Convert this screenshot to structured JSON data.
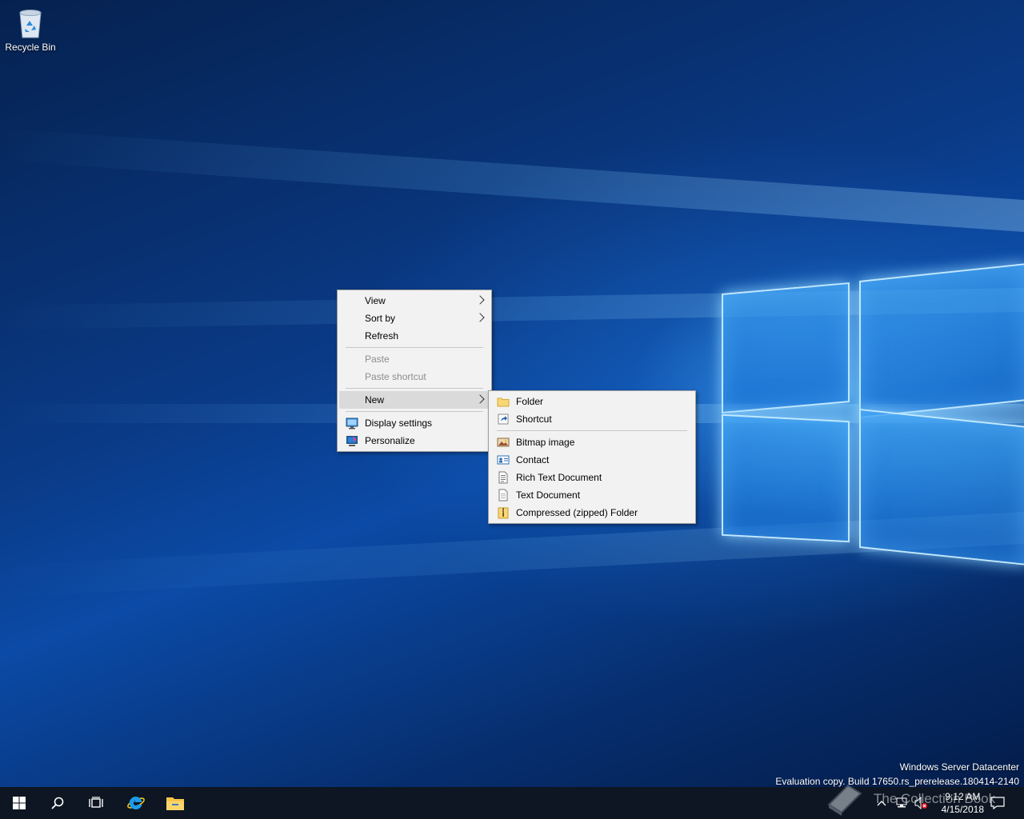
{
  "desktop": {
    "icons": [
      {
        "label": "Recycle Bin",
        "icon": "recycle-bin-icon"
      }
    ],
    "watermark": {
      "edition": "Windows Server Datacenter",
      "build": "Evaluation copy. Build 17650.rs_prerelease.180414-2140"
    }
  },
  "context_menu": {
    "view": "View",
    "sort_by": "Sort by",
    "refresh": "Refresh",
    "paste": "Paste",
    "paste_shortcut": "Paste shortcut",
    "new": "New",
    "display_settings": "Display settings",
    "personalize": "Personalize"
  },
  "new_submenu": {
    "folder": "Folder",
    "shortcut": "Shortcut",
    "bitmap": "Bitmap image",
    "contact": "Contact",
    "rtf": "Rich Text Document",
    "text": "Text Document",
    "zip": "Compressed (zipped) Folder"
  },
  "taskbar": {
    "pinned": [
      "start-icon",
      "search-icon",
      "task-view-icon",
      "internet-explorer-icon",
      "file-explorer-icon"
    ],
    "clock": {
      "time": "9:12 AM",
      "date": "4/15/2018"
    },
    "overlay_text": "The Collection Book"
  },
  "colors": {
    "menu_bg": "#f2f2f2",
    "highlight": "#dadada",
    "taskbar": "#0d1622",
    "accent": "#0078d7"
  }
}
